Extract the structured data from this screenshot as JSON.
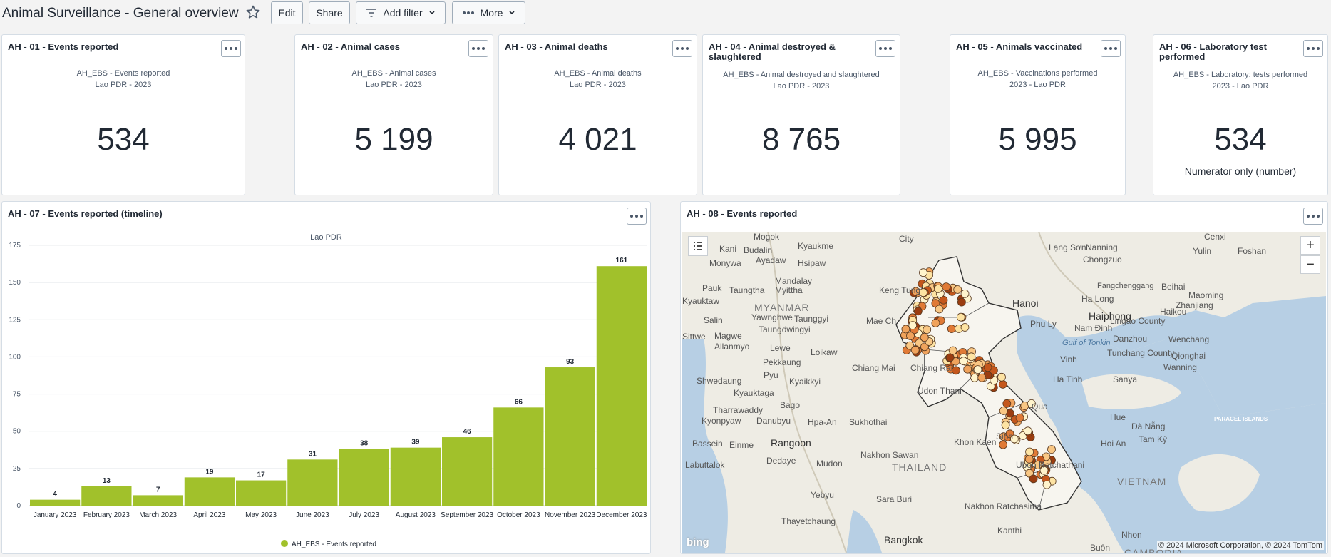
{
  "header": {
    "title": "Animal Surveillance - General overview",
    "edit_label": "Edit",
    "share_label": "Share",
    "add_filter_label": "Add filter",
    "more_label": "More"
  },
  "kpis": [
    {
      "title": "AH - 01 - Events reported",
      "sub1": "AH_EBS - Events reported",
      "sub2": "Lao PDR - 2023",
      "value": "534",
      "note": ""
    },
    {
      "title": "AH - 02 - Animal cases",
      "sub1": "AH_EBS - Animal cases",
      "sub2": "Lao PDR - 2023",
      "value": "5 199",
      "note": ""
    },
    {
      "title": "AH - 03 - Animal deaths",
      "sub1": "AH_EBS - Animal deaths",
      "sub2": "Lao PDR - 2023",
      "value": "4 021",
      "note": ""
    },
    {
      "title": "AH - 04 - Animal destroyed & slaughtered",
      "sub1": "AH_EBS - Animal destroyed and slaughtered",
      "sub2": "Lao PDR - 2023",
      "value": "8 765",
      "note": ""
    },
    {
      "title": "AH - 05 - Animals vaccinated",
      "sub1": "AH_EBS - Vaccinations performed",
      "sub2": "2023 - Lao PDR",
      "value": "5 995",
      "note": ""
    },
    {
      "title": "AH - 06 - Laboratory test performed",
      "sub1": "AH_EBS - Laboratory: tests performed",
      "sub2": "2023 - Lao PDR",
      "value": "534",
      "note": "Numerator only (number)"
    }
  ],
  "timeline": {
    "title": "AH - 07 - Events reported (timeline)",
    "subtitle": "Lao PDR"
  },
  "chart_data": {
    "type": "bar",
    "title": "Lao PDR",
    "categories": [
      "January 2023",
      "February 2023",
      "March 2023",
      "April 2023",
      "May 2023",
      "June 2023",
      "July 2023",
      "August 2023",
      "September 2023",
      "October 2023",
      "November 2023",
      "December 2023"
    ],
    "series": [
      {
        "name": "AH_EBS - Events reported",
        "values": [
          4,
          13,
          7,
          19,
          17,
          31,
          38,
          39,
          46,
          66,
          93,
          161
        ]
      }
    ],
    "yticks": [
      0,
      25,
      50,
      75,
      100,
      125,
      150,
      175
    ],
    "ylim": [
      0,
      175
    ],
    "grid": true,
    "legend": "bottom",
    "color": "#a1c12b"
  },
  "map": {
    "title": "AH - 08 - Events reported",
    "attribution": "© 2024 Microsoft Corporation, © 2024 TomTom",
    "logo": "bing",
    "labels": [
      "Mogok",
      "Kani",
      "Budalin",
      "Kyaukme",
      "Monywa",
      "Ayadaw",
      "Hsipaw",
      "Mandalay",
      "Myittha",
      "Pauk",
      "Taungtha",
      "MYANMAR",
      "Kyauktaw",
      "Yawnghwe",
      "Taunggyi",
      "Salin",
      "Taungdwingyi",
      "Magwe",
      "Allanmyo",
      "Lewe",
      "Loikaw",
      "Sittwe",
      "Pyu",
      "Pekkaung",
      "Shwedaung",
      "Kyauktaga",
      "Kyaikkyi",
      "Tharrawaddy",
      "Kyonpyaw",
      "Danubyu",
      "Hpa-An",
      "Sukhothai",
      "Bago",
      "Bassein",
      "Einme",
      "Rangoon",
      "Labuttalok",
      "Dedaye",
      "Mudon",
      "Nakhon Sawan",
      "THAILAND",
      "Yebyu",
      "Sara Buri",
      "Thayetchaung",
      "Bangkok",
      "Nakhon Ratchasima",
      "Chiang Mai",
      "Chiang Rai",
      "Keng Tung",
      "Mae Ch",
      "Udon Thani",
      "Khon Kaen",
      "Ubon Ratchathani",
      "Hanoi",
      "Phu Ly",
      "Haiphong",
      "Nam Định",
      "Lạng Sơn",
      "Ha Long",
      "Lingao County",
      "Haikou",
      "Danzhou",
      "Wenchang",
      "Gulf of Tonkin",
      "Qionghai",
      "Tunchang County",
      "Wanning",
      "Sanya",
      "Vinh",
      "Ha Tinh",
      "Hue",
      "Đà Nẵng",
      "Tam Kỳ",
      "PARACEL ISLANDS",
      "Hoi An",
      "VIETNAM",
      "Nanning",
      "Chongzuo",
      "Beihai",
      "Maoming",
      "Zhanjiang",
      "Fangchenggang",
      "Yulin",
      "Foshan",
      "Cenxi",
      "Sinh",
      "Kanthi",
      "Qua",
      "Nhon",
      "CAMBODIA",
      "City",
      "Buôn"
    ]
  }
}
